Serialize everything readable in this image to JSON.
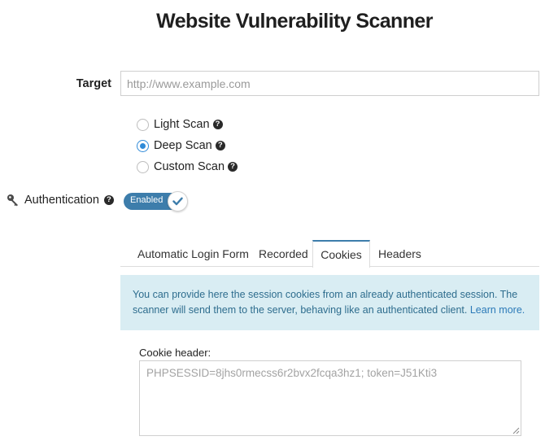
{
  "title": "Website Vulnerability Scanner",
  "target": {
    "label": "Target",
    "placeholder": "http://www.example.com",
    "value": ""
  },
  "scan_types": [
    {
      "label": "Light Scan",
      "checked": false
    },
    {
      "label": "Deep Scan",
      "checked": true
    },
    {
      "label": "Custom Scan",
      "checked": false
    }
  ],
  "auth": {
    "label": "Authentication",
    "toggle_label": "Enabled",
    "enabled": true
  },
  "tabs": [
    {
      "label": "Automatic Login Form",
      "active": false
    },
    {
      "label": "Recorded",
      "active": false
    },
    {
      "label": "Cookies",
      "active": true
    },
    {
      "label": "Headers",
      "active": false
    }
  ],
  "info": {
    "text": "You can provide here the session cookies from an already authenticated session. The scanner will send them to the server, behaving like an authenticated client.",
    "link": "Learn more."
  },
  "cookie": {
    "label": "Cookie header:",
    "placeholder": "PHPSESSID=8jhs0rmecss6r2bvx2fcqa3hz1; token=J51Kti3"
  },
  "colors": {
    "accent": "#3d7dab",
    "radio": "#2f8ad8",
    "info_bg": "#d9edf3",
    "info_text": "#2e6d8e"
  },
  "icons": {
    "auth": "key-icon",
    "help": "question-circle-icon",
    "toggle": "check-icon",
    "resize": "resize-grip-icon"
  }
}
